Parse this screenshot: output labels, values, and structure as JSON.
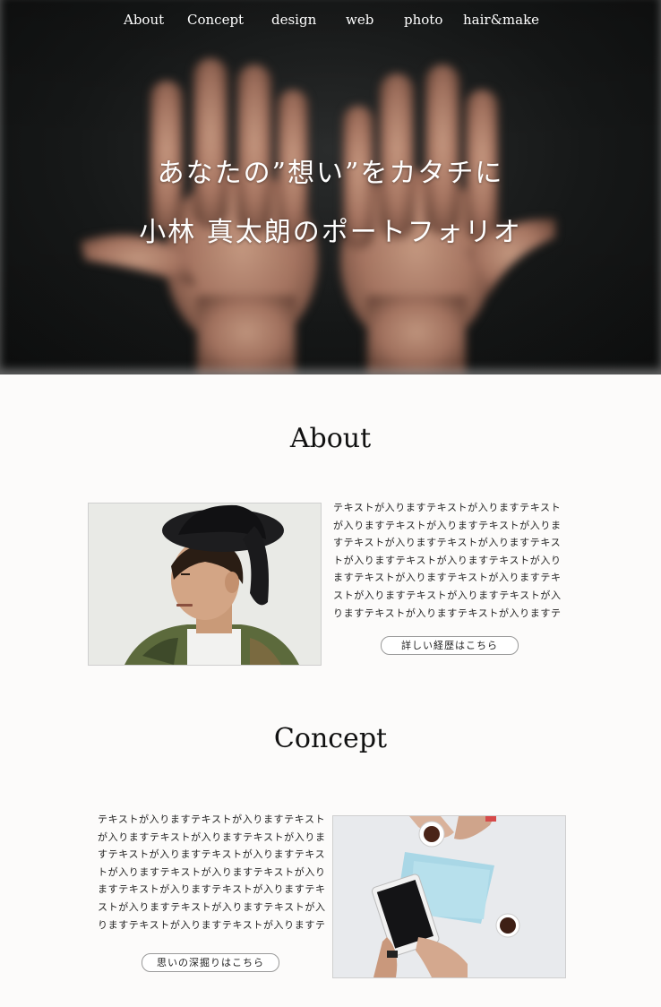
{
  "nav": {
    "items": [
      "About",
      "Concept",
      "design",
      "web",
      "photo",
      "hair&make"
    ]
  },
  "hero": {
    "line1": "あなたの”想い”をカタチに",
    "line2": "小林 真太朗のポートフォリオ"
  },
  "about": {
    "title": "About",
    "text": "テキストが入りますテキストが入りますテキストが入りますテキストが入りますテキストが入りますテキストが入りますテキストが入りますテキストが入りますテキストが入りますテキストが入りますテキストが入りますテキストが入りますテキストが入りますテキストが入りますテキストが入りますテキストが入りますテキストが入りますテキストが入りますテキストが入りますテ",
    "button": "詳しい経歴はこちら"
  },
  "concept": {
    "title": "Concept",
    "text": "テキストが入りますテキストが入りますテキストが入りますテキストが入りますテキストが入りますテキストが入りますテキストが入りますテキストが入りますテキストが入りますテキストが入りますテキストが入りますテキストが入りますテキストが入りますテキストが入りますテキストが入りますテキストが入りますテキストが入りますテキストが入りますテキストが入りますテ",
    "button": "思いの深掘りはこちら"
  },
  "icons": {
    "hero_image": "open-hands-photo",
    "about_image": "portrait-man-in-hat-photo",
    "concept_image": "desk-with-tablet-and-coffee-photo"
  }
}
